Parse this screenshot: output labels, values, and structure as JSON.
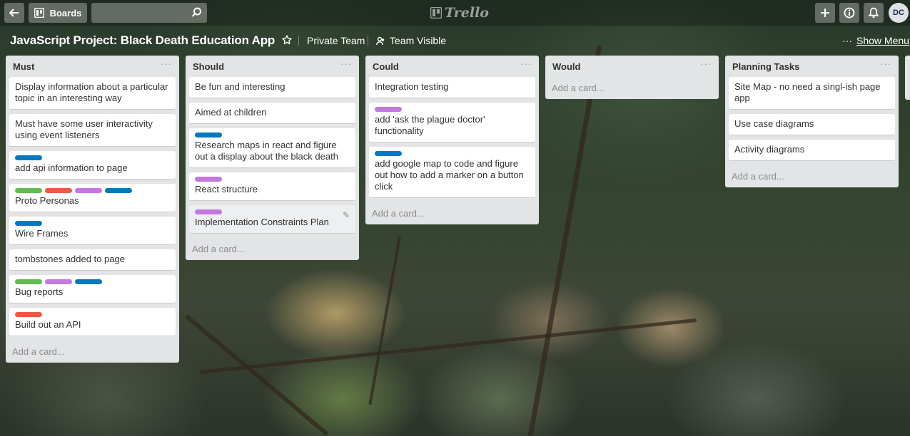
{
  "header": {
    "back_icon": "arrow-left-icon",
    "boards_label": "Boards",
    "search_placeholder": "",
    "logo_text": "Trello",
    "add_icon": "plus-icon",
    "info_icon": "info-icon",
    "notifications_icon": "bell-icon",
    "avatar_initials": "DC"
  },
  "board": {
    "title": "JavaScript Project: Black Death Education App",
    "team": "Private Team",
    "visibility": "Team Visible",
    "menu_dots": "···",
    "show_menu": "Show Menu"
  },
  "colors": {
    "green": "#61bd4f",
    "red": "#eb5a46",
    "purple": "#c377e0",
    "blue": "#0079bf"
  },
  "add_card_label": "Add a card...",
  "lists": [
    {
      "title": "Must",
      "menu": "···",
      "cards": [
        {
          "labels": [],
          "text": "Display information about a particular topic in an interesting way"
        },
        {
          "labels": [],
          "text": "Must have some user interactivity using event listeners"
        },
        {
          "labels": [
            "blue"
          ],
          "text": "add api information to page"
        },
        {
          "labels": [
            "green",
            "red",
            "purple",
            "blue"
          ],
          "text": "Proto Personas"
        },
        {
          "labels": [
            "blue"
          ],
          "text": "Wire Frames"
        },
        {
          "labels": [],
          "text": "tombstones added to page"
        },
        {
          "labels": [
            "green",
            "purple",
            "blue"
          ],
          "text": "Bug reports"
        },
        {
          "labels": [
            "red"
          ],
          "text": "Build out an API"
        }
      ]
    },
    {
      "title": "Should",
      "menu": "···",
      "cards": [
        {
          "labels": [],
          "text": "Be fun and interesting"
        },
        {
          "labels": [],
          "text": "Aimed at children"
        },
        {
          "labels": [
            "blue"
          ],
          "text": "Research maps in react and figure out a display about the black death"
        },
        {
          "labels": [
            "purple"
          ],
          "text": "React structure"
        },
        {
          "labels": [
            "purple"
          ],
          "text": "Implementation Constraints Plan",
          "hover": true
        }
      ]
    },
    {
      "title": "Could",
      "menu": "···",
      "cards": [
        {
          "labels": [],
          "text": "Integration testing"
        },
        {
          "labels": [
            "purple"
          ],
          "text": "add 'ask the plague doctor' functionality"
        },
        {
          "labels": [
            "blue"
          ],
          "text": "add google map to code and figure out how to add a marker on a button click"
        }
      ]
    },
    {
      "title": "Would",
      "menu": "···",
      "cards": []
    },
    {
      "title": "Planning Tasks",
      "menu": "···",
      "cards": [
        {
          "labels": [],
          "text": "Site Map - no need a singl-ish page app"
        },
        {
          "labels": [],
          "text": "Use case diagrams"
        },
        {
          "labels": [],
          "text": "Activity diagrams"
        }
      ]
    }
  ]
}
